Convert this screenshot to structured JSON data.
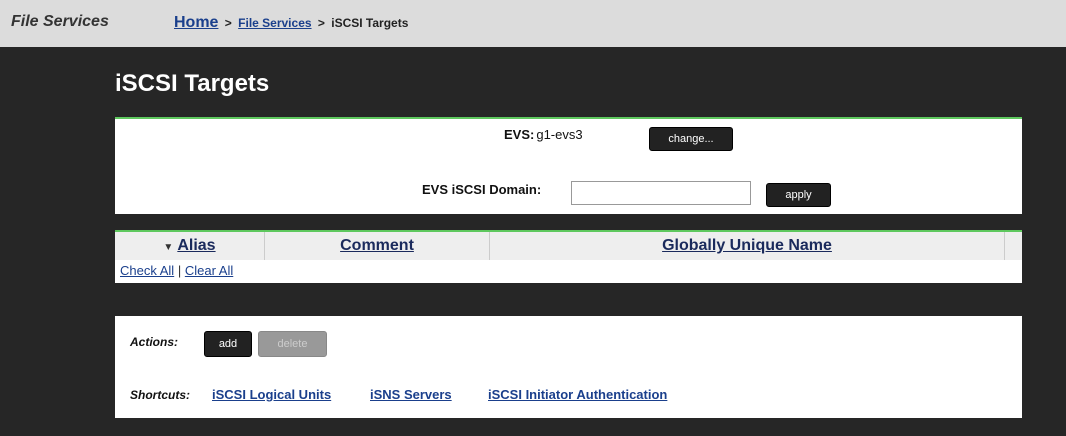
{
  "header": {
    "app_title": "File Services",
    "breadcrumbs": [
      {
        "label": "Home"
      },
      {
        "label": "File Services"
      },
      {
        "label": "iSCSI Targets"
      }
    ],
    "separator": ">"
  },
  "page": {
    "title": "iSCSI Targets"
  },
  "evs": {
    "label": "EVS:",
    "value": "g1-evs3",
    "change_label": "change...",
    "domain_label": "EVS iSCSI Domain:",
    "domain_value": "",
    "apply_label": "apply"
  },
  "table": {
    "sort_indicator": "▼",
    "columns": [
      {
        "label": "Alias"
      },
      {
        "label": "Comment"
      },
      {
        "label": "Globally Unique Name"
      }
    ],
    "rows": [],
    "check_all": "Check All",
    "divider": "|",
    "clear_all": "Clear All"
  },
  "actions": {
    "label": "Actions:",
    "add": "add",
    "delete": "delete",
    "shortcuts_label": "Shortcuts:",
    "shortcuts": [
      "iSCSI Logical Units",
      "iSNS Servers",
      "iSCSI Initiator Authentication"
    ]
  },
  "colors": {
    "accent_green": "#5ec85e",
    "background": "#262626",
    "link": "#1a3f8c"
  }
}
